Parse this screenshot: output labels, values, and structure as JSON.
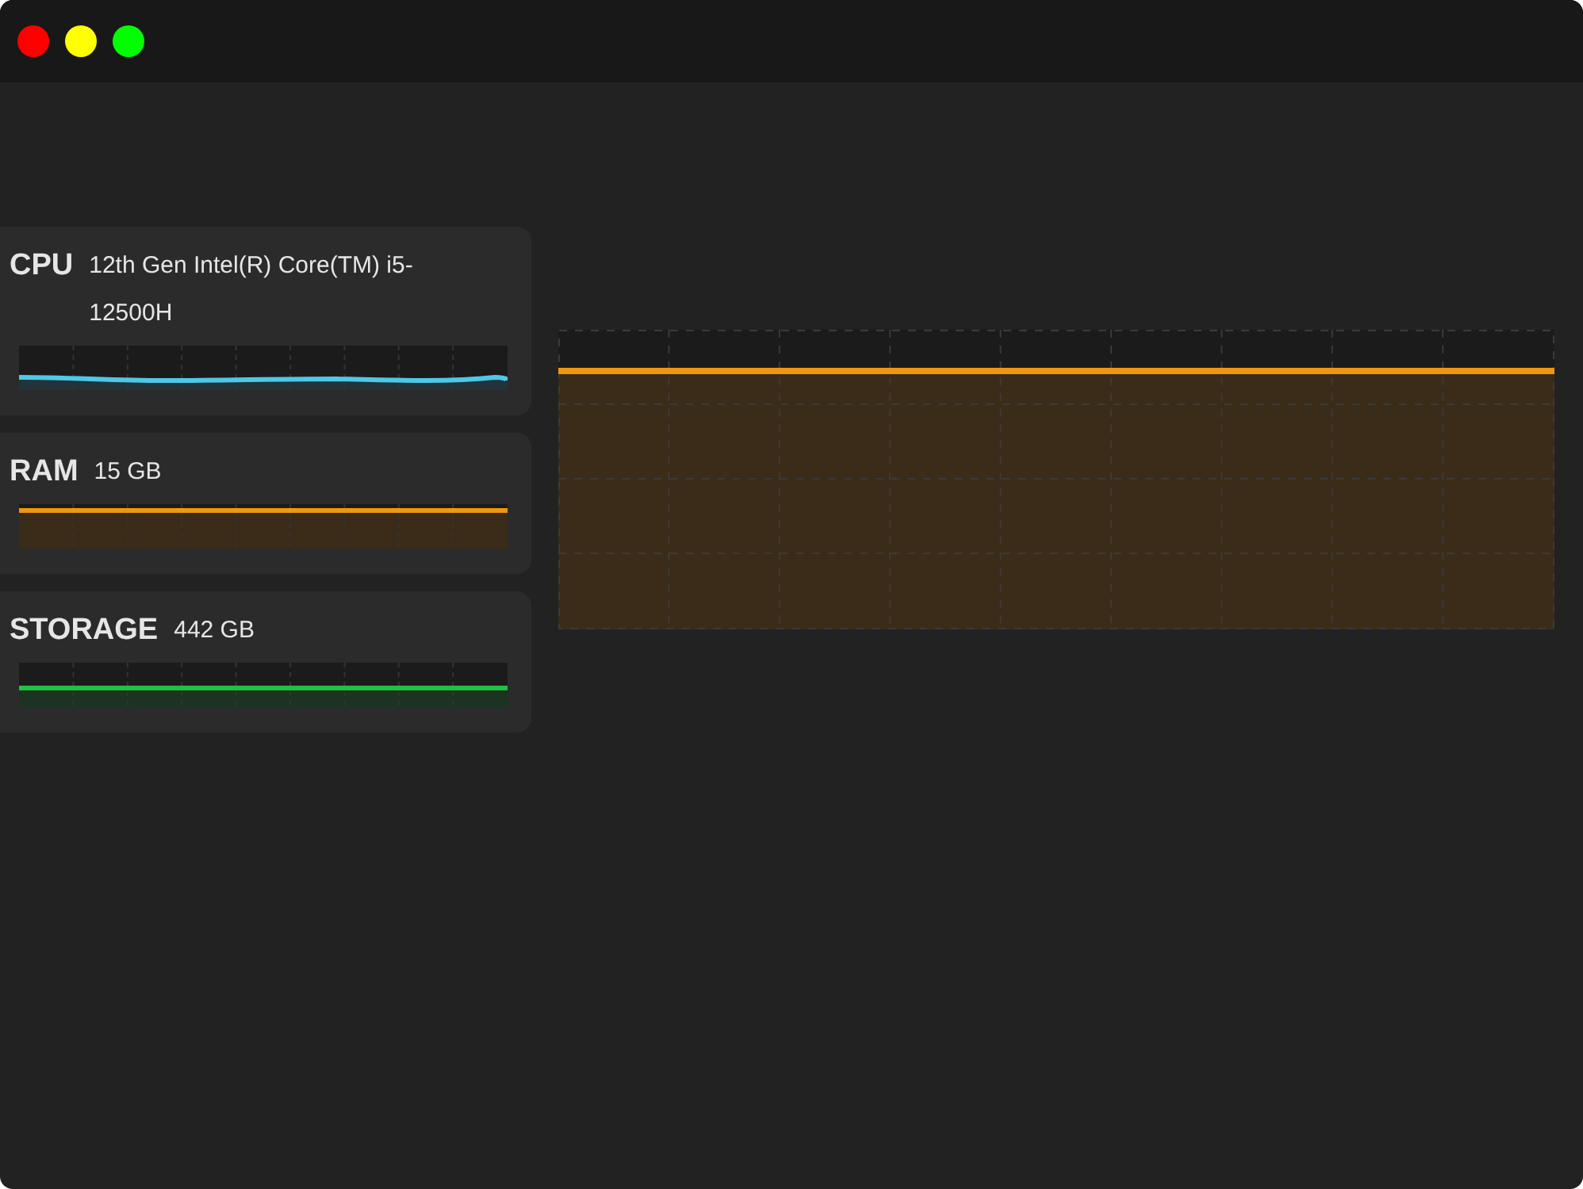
{
  "monitors": [
    {
      "label": "CPU",
      "value": "12th Gen Intel(R) Core(TM) i5-12500H",
      "color": "#4fc8e8",
      "kind": "wave"
    },
    {
      "label": "RAM",
      "value": "15 GB",
      "color": "#f0960f",
      "kind": "flat"
    },
    {
      "label": "STORAGE",
      "value": "442 GB",
      "color": "#20c040",
      "kind": "flat"
    }
  ],
  "graph": {
    "color": "#f0960f"
  }
}
